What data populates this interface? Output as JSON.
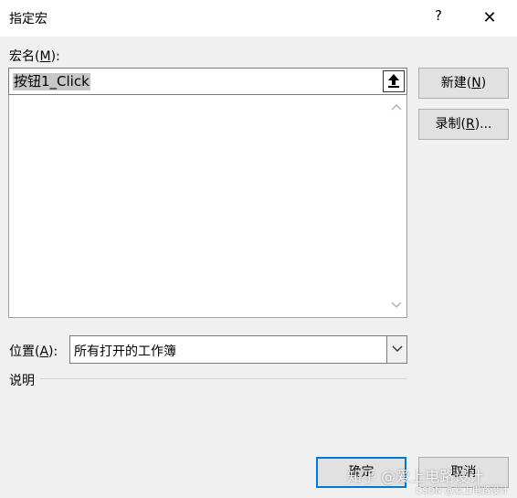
{
  "window": {
    "title": "指定宏",
    "help_glyph": "?",
    "close_glyph": "✕"
  },
  "macro_name": {
    "label_prefix": "宏名(",
    "label_key": "M",
    "label_suffix": "):",
    "value": "按钮1_Click"
  },
  "macro_list": {
    "items": []
  },
  "buttons": {
    "new_prefix": "新建(",
    "new_key": "N",
    "new_suffix": ")",
    "record_prefix": "录制(",
    "record_key": "R",
    "record_suffix": ")...",
    "ok_label": "确定",
    "cancel_label": "取消"
  },
  "location": {
    "label_prefix": "位置(",
    "label_key": "A",
    "label_suffix": "):",
    "selected": "所有打开的工作簿"
  },
  "description": {
    "label": "说明"
  },
  "watermark": {
    "main": "知乎 @爱上电路设计",
    "sub": "CSDN @爱上电路设计"
  },
  "colors": {
    "accent": "#0078d7",
    "button_bg": "#e1e1e1",
    "dialog_bg": "#f0f0f0"
  }
}
